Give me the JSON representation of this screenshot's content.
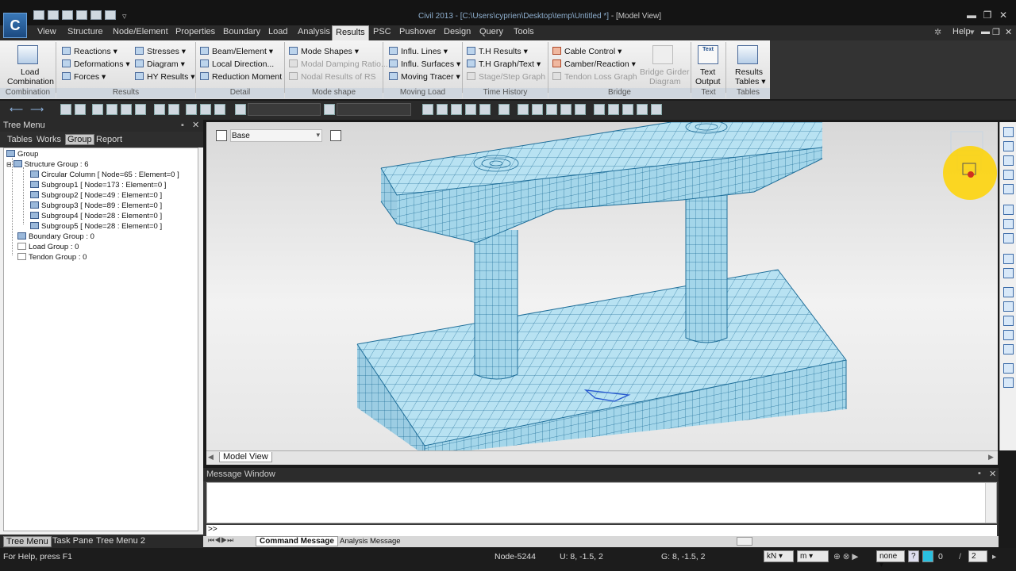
{
  "window": {
    "title_path": "Civil 2013 - [C:\\Users\\cyprien\\Desktop\\temp\\Untitled *]",
    "title_tail": " - [Model View]"
  },
  "menu": [
    "View",
    "Structure",
    "Node/Element",
    "Properties",
    "Boundary",
    "Load",
    "Analysis",
    "Results",
    "PSC",
    "Pushover",
    "Design",
    "Query",
    "Tools"
  ],
  "menu_active": "Results",
  "help_label": "Help",
  "ribbon": {
    "load_combination": "Load\nCombination",
    "load_label_1": "Load",
    "load_label_2": "Combination",
    "results_col1": [
      "Reactions",
      "Deformations",
      "Forces"
    ],
    "results_col2": [
      "Stresses",
      "Diagram",
      "HY Results"
    ],
    "detail": [
      "Beam/Element",
      "Local Direction...",
      "Reduction Moment"
    ],
    "mode_shape": [
      "Mode Shapes",
      "Modal Damping Ratio...",
      "Nodal Results of RS"
    ],
    "moving_load": [
      "Influ. Lines",
      "Influ. Surfaces",
      "Moving Tracer"
    ],
    "time_history": [
      "T.H Results",
      "T.H Graph/Text",
      "Stage/Step Graph"
    ],
    "bridge": [
      "Cable Control",
      "Camber/Reaction",
      "Tendon Loss Graph"
    ],
    "bridge_girder_1": "Bridge Girder",
    "bridge_girder_2": "Diagram",
    "text_output_1": "Text",
    "text_output_2": "Output",
    "results_tables_1": "Results",
    "results_tables_2": "Tables",
    "text_icon": "Text",
    "groups": [
      "Combination",
      "Results",
      "Detail",
      "Mode shape",
      "Moving Load",
      "Time History",
      "Bridge",
      "Text",
      "Tables"
    ]
  },
  "tree": {
    "header": "Tree Menu",
    "tabs": [
      "Tables",
      "Works",
      "Group",
      "Report"
    ],
    "active_tab": "Group",
    "nodes": [
      "Group",
      "Structure Group : 6",
      "Circular Column [ Node=65 : Element=0 ]",
      "Subgroup1 [ Node=173 : Element=0 ]",
      "Subgroup2 [ Node=49 : Element=0 ]",
      "Subgroup3 [ Node=89 : Element=0 ]",
      "Subgroup4 [ Node=28 : Element=0 ]",
      "Subgroup5 [ Node=28 : Element=0 ]",
      "Boundary Group : 0",
      "Load Group : 0",
      "Tendon Group : 0"
    ],
    "footer_tabs": [
      "Tree Menu",
      "Task Pane",
      "Tree Menu 2"
    ]
  },
  "view": {
    "base_select": "Base",
    "tab": "Model View"
  },
  "message": {
    "header": "Message Window",
    "prompt": ">>",
    "tabs": [
      "Command Message",
      "Analysis Message"
    ]
  },
  "status": {
    "help": "For Help, press F1",
    "node": "Node-5244",
    "u": "U: 8, -1.5, 2",
    "g": "G: 8, -1.5, 2",
    "force_unit": "kN",
    "length_unit": "m",
    "none": "none",
    "zero": "0",
    "page": "2"
  },
  "colors": {
    "mesh_fill": "#a8d8ec",
    "mesh_line": "#1f6e99",
    "highlight": "#ffd400"
  }
}
